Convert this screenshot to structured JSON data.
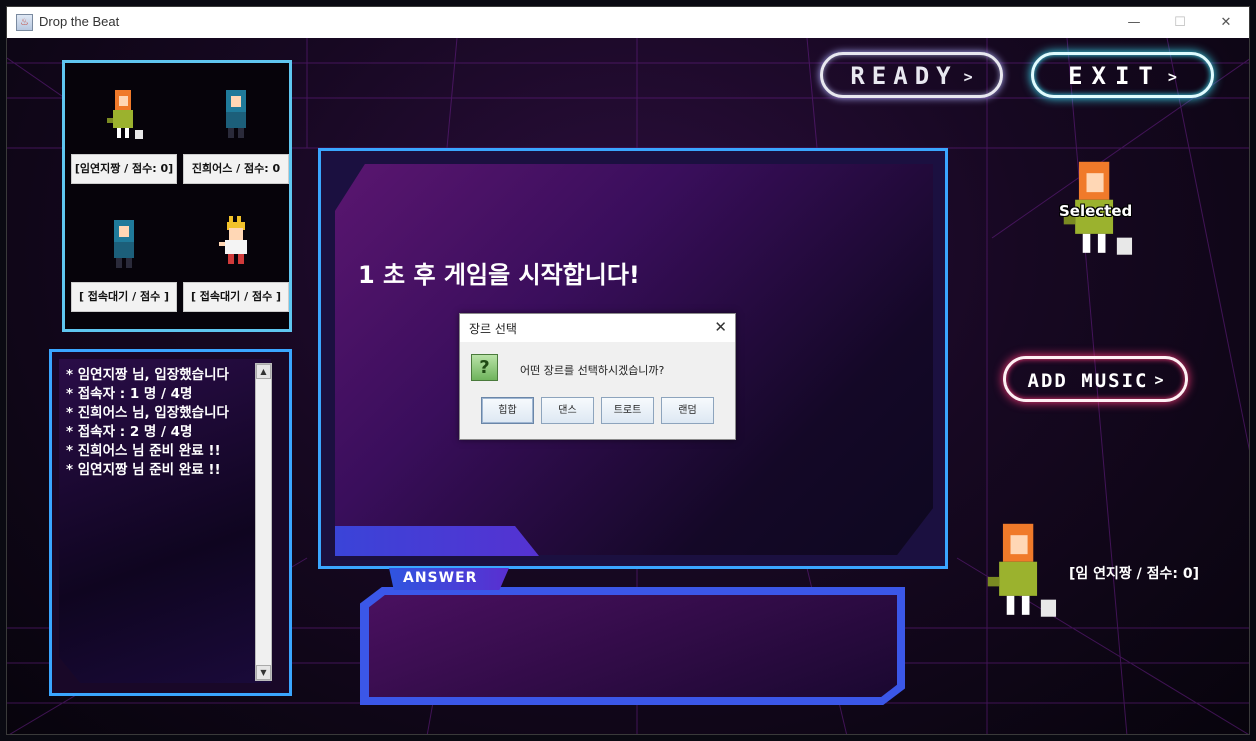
{
  "window": {
    "title": "Drop the Beat",
    "controls": {
      "minimize": "—",
      "maximize": "☐",
      "close": "✕"
    }
  },
  "players": [
    {
      "label": "[임연지짱 / 점수: 0]",
      "sprite": "orange-hair-girl"
    },
    {
      "label": "진희어스 / 점수: 0",
      "sprite": "blue-hood-boy"
    },
    {
      "label": "[ 접속대기 / 점수 ]",
      "sprite": "blue-hood-boy"
    },
    {
      "label": "[ 접속대기 / 점수 ]",
      "sprite": "blonde-spiky-boy"
    }
  ],
  "chat": {
    "lines": [
      "* 임연지짱 님, 입장했습니다",
      "* 접속자 : 1 명 / 4명",
      "* 진희어스 님, 입장했습니다",
      "* 접속자 : 2 명 / 4명",
      "* 진희어스 님 준비 완료 !!",
      "* 임연지짱 님 준비 완료 !!"
    ],
    "scroll_up": "▲",
    "scroll_down": "▼"
  },
  "main": {
    "countdown": "1 초 후 게임을 시작합니다!",
    "answer_label": "ANSWER"
  },
  "buttons": {
    "ready": "READY",
    "exit": "EXIT",
    "add_music": "ADD MUSIC",
    "chevron": ">"
  },
  "selected": {
    "label": "Selected"
  },
  "me": {
    "label": "[임 연지짱 / 점수: 0]"
  },
  "dialog": {
    "title": "장르 선택",
    "close": "✕",
    "icon": "?",
    "message": "어떤 장르를 선택하시겠습니까?",
    "options": [
      "힙합",
      "댄스",
      "트로트",
      "랜덤"
    ]
  },
  "colors": {
    "accent_blue": "#3aa6ff",
    "neon_cyan": "#3ee8ff",
    "neon_pink": "#ff3a7a"
  }
}
